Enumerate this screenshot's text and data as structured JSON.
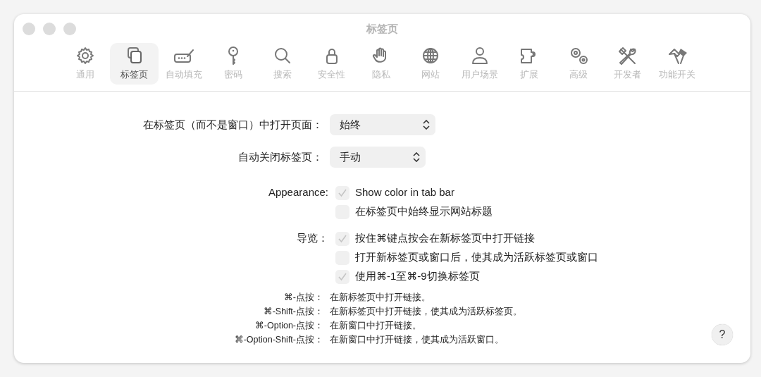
{
  "window": {
    "title": "标签页"
  },
  "toolbar": [
    {
      "label": "通用",
      "selected": false
    },
    {
      "label": "标签页",
      "selected": true
    },
    {
      "label": "自动填充",
      "selected": false
    },
    {
      "label": "密码",
      "selected": false
    },
    {
      "label": "搜索",
      "selected": false
    },
    {
      "label": "安全性",
      "selected": false
    },
    {
      "label": "隐私",
      "selected": false
    },
    {
      "label": "网站",
      "selected": false
    },
    {
      "label": "用户场景",
      "selected": false
    },
    {
      "label": "扩展",
      "selected": false
    },
    {
      "label": "高级",
      "selected": false
    },
    {
      "label": "开发者",
      "selected": false
    },
    {
      "label": "功能开关",
      "selected": false
    }
  ],
  "settings": [
    {
      "label": "在标签页（而不是窗口）中打开页面：",
      "value": "始终"
    },
    {
      "label": "自动关闭标签页：",
      "value": "手动"
    }
  ],
  "option_groups": [
    {
      "label": "Appearance:",
      "options": [
        {
          "text": "Show color in tab bar",
          "checked": true
        },
        {
          "text": "在标签页中始终显示网站标题",
          "checked": false
        }
      ]
    },
    {
      "label": "导览：",
      "options": [
        {
          "text": "按住⌘键点按会在新标签页中打开链接",
          "checked": true
        },
        {
          "text": "打开新标签页或窗口后，使其成为活跃标签页或窗口",
          "checked": false
        },
        {
          "text": "使用⌘-1至⌘-9切换标签页",
          "checked": true
        }
      ]
    }
  ],
  "shortcuts": [
    {
      "keys": "⌘-点按：",
      "description": "在新标签页中打开链接。"
    },
    {
      "keys": "⌘-Shift-点按：",
      "description": "在新标签页中打开链接，使其成为活跃标签页。"
    },
    {
      "keys": "⌘-Option-点按：",
      "description": "在新窗口中打开链接。"
    },
    {
      "keys": "⌘-Option-Shift-点按：",
      "description": "在新窗口中打开链接，使其成为活跃窗口。"
    }
  ],
  "help_button": {
    "label": "?"
  }
}
